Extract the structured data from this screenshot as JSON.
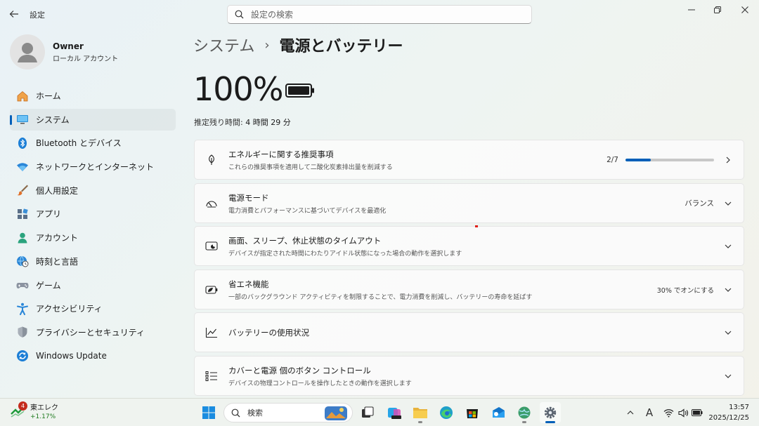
{
  "window": {
    "title": "設定",
    "search_placeholder": "設定の検索"
  },
  "profile": {
    "name": "Owner",
    "account_type": "ローカル アカウント"
  },
  "sidebar": {
    "items": [
      {
        "label": "ホーム",
        "icon": "home-icon"
      },
      {
        "label": "システム",
        "icon": "system-icon",
        "active": true
      },
      {
        "label": "Bluetooth とデバイス",
        "icon": "bluetooth-icon"
      },
      {
        "label": "ネットワークとインターネット",
        "icon": "network-icon"
      },
      {
        "label": "個人用設定",
        "icon": "brush-icon"
      },
      {
        "label": "アプリ",
        "icon": "apps-icon"
      },
      {
        "label": "アカウント",
        "icon": "account-icon"
      },
      {
        "label": "時刻と言語",
        "icon": "globe-clock-icon"
      },
      {
        "label": "ゲーム",
        "icon": "gamepad-icon"
      },
      {
        "label": "アクセシビリティ",
        "icon": "accessibility-icon"
      },
      {
        "label": "プライバシーとセキュリティ",
        "icon": "shield-icon"
      },
      {
        "label": "Windows Update",
        "icon": "update-icon"
      }
    ]
  },
  "breadcrumb": {
    "parent": "システム",
    "separator": "›",
    "current": "電源とバッテリー"
  },
  "battery": {
    "percent": "100%",
    "remaining_label": "推定残り時間:",
    "remaining_value": "4 時間 29 分"
  },
  "cards": [
    {
      "title": "エネルギーに関する推奨事項",
      "subtitle": "これらの推奨事項を適用して二酸化炭素排出量を削減する",
      "right_text": "2/7",
      "progress": 0.2857,
      "icon": "leaf-icon",
      "chevron": "right"
    },
    {
      "title": "電源モード",
      "subtitle": "電力消費とパフォーマンスに基づいてデバイスを最適化",
      "right_text": "バランス",
      "icon": "gauge-icon",
      "chevron": "down"
    },
    {
      "title": "画面、スリープ、休止状態のタイムアウト",
      "subtitle": "デバイスが指定された時間にわたりアイドル状態になった場合の動作を選択します",
      "right_text": "",
      "icon": "screen-sleep-icon",
      "chevron": "down"
    },
    {
      "title": "省エネ機能",
      "subtitle": "一部のバックグラウンド アクティビティを制限することで、電力消費を削減し、バッテリーの寿命を延ばす",
      "right_text": "30% でオンにする",
      "icon": "battery-saver-icon",
      "chevron": "down"
    },
    {
      "title": "バッテリーの使用状況",
      "subtitle": "",
      "right_text": "",
      "icon": "chart-line-icon",
      "chevron": "down"
    },
    {
      "title": "カバーと電源 個のボタン コントロール",
      "subtitle": "デバイスの物理コントロールを操作したときの動作を選択します",
      "right_text": "",
      "icon": "list-icon",
      "chevron": "down"
    }
  ],
  "taskbar": {
    "stock_badge": "4",
    "stock_name": "東エレク",
    "stock_change": "+1.17%",
    "search_label": "検索",
    "time": "13:57",
    "date": "2025/12/25",
    "ime_mode": "A"
  },
  "colors": {
    "accent": "#005fb8",
    "badge": "#c42b1c",
    "stock_up": "#1e7a1e"
  }
}
